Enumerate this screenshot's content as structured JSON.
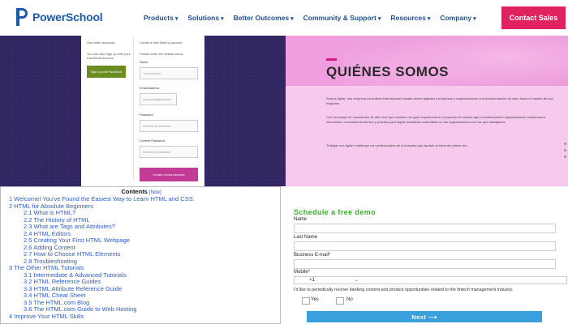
{
  "nav": {
    "brand": "PowerSchool",
    "items": [
      "Products",
      "Solutions",
      "Better Outcomes",
      "Community & Support",
      "Resources",
      "Company"
    ],
    "cta": "Contact Sales"
  },
  "signup": {
    "other_accounts": "Use other accounts",
    "facebook_hint": "You can also sign up with your Facebook Account",
    "facebook_button": "Sign Up with Facebook",
    "create_heading": "Create a new Note.ly account",
    "create_hint": "Please enter the details below",
    "name_label": "Name",
    "name_placeholder": "Your full name",
    "email_label": "Email Address",
    "email_placeholder": "yourname@gmail.com",
    "password_label": "Password",
    "password_placeholder": "Minimum 8 characters",
    "confirm_label": "Confirm Password",
    "confirm_placeholder": "Minimum 8 characters",
    "create_button": "Create a new account"
  },
  "about": {
    "title": "QUIÉNES SOMOS",
    "para1": "Somos Agilar, una empresa consultora internacional basada dentro agilidad a empresas y organizaciones una transformación de valor hacia el cambio de sus negocios.",
    "para2": "Con un equipo de consultores de alto nivel que cuentan con gran experiencia en proyectos de cambio ágil y transformación organizacional, combinamos innovación, conocimiento técnico y práctica para lograr resultados sostenibles en las organizaciones con las que trabajamos.",
    "para3": "Trabajar con Agilar contribuye con profesionales de la industria que ayudan al inicio del primer día."
  },
  "toc": {
    "title": "Contents",
    "hide": "[hide]",
    "rows": [
      {
        "num": "1",
        "text": "Welcome! You've Found the Easiest Way to Learn HTML and CSS.",
        "level": 1
      },
      {
        "num": "2",
        "text": "HTML for Absolute Beginners",
        "level": 1
      },
      {
        "num": "2.1",
        "text": "What is HTML?",
        "level": 2
      },
      {
        "num": "2.2",
        "text": "The History of HTML",
        "level": 2
      },
      {
        "num": "2.3",
        "text": "What are Tags and Attributes?",
        "level": 2
      },
      {
        "num": "2.4",
        "text": "HTML Editors",
        "level": 2
      },
      {
        "num": "2.5",
        "text": "Creating Your First HTML Webpage",
        "level": 2
      },
      {
        "num": "2.6",
        "text": "Adding Content",
        "level": 2
      },
      {
        "num": "2.7",
        "text": "How to Choose HTML Elements",
        "level": 2
      },
      {
        "num": "2.8",
        "text": "Troubleshooting",
        "level": 2
      },
      {
        "num": "3",
        "text": "The Other HTML Tutorials",
        "level": 1
      },
      {
        "num": "3.1",
        "text": "Intermediate & Advanced Tutorials",
        "level": 2
      },
      {
        "num": "3.2",
        "text": "HTML Reference Guides",
        "level": 2
      },
      {
        "num": "3.3",
        "text": "HTML Attribute Reference Guide",
        "level": 2
      },
      {
        "num": "3.4",
        "text": "HTML Cheat Sheet",
        "level": 2
      },
      {
        "num": "3.5",
        "text": "The HTML.com Blog",
        "level": 2
      },
      {
        "num": "3.6",
        "text": "The HTML.com Guide to Web Hosting",
        "level": 2
      },
      {
        "num": "4",
        "text": "Improve Your HTML Skills",
        "level": 1
      }
    ]
  },
  "demo": {
    "title": "Schedule a free demo",
    "name_label": "Name",
    "lastname_label": "Last Name",
    "business_email_label": "Business E-mail*",
    "mobile_label": "Mobile*",
    "country_code": "+1",
    "consent": "I'd like to periodically receive banking content and product opportunities related to the fintech management industry.",
    "yes": "Yes",
    "no": "No",
    "next": "Next ⟶"
  },
  "colors": {
    "brand_blue": "#1f5aa8",
    "cta_pink": "#e0235f",
    "demo_green": "#39b02a",
    "next_blue": "#3a9fdd"
  }
}
